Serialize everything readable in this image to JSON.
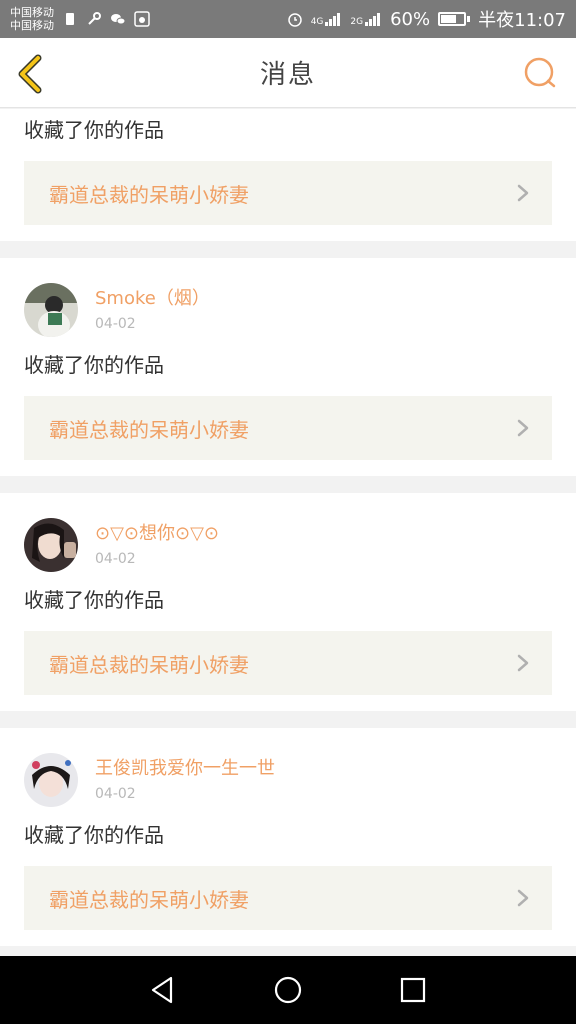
{
  "status_bar": {
    "carrier_1": "中国移动",
    "carrier_2": "中国移动",
    "network_1": "4G",
    "network_2": "2G",
    "battery": "60%",
    "time": "半夜11:07"
  },
  "nav": {
    "title": "消息",
    "accent_color": "#f0a065"
  },
  "messages": [
    {
      "action": "收藏了你的作品",
      "work_title": "霸道总裁的呆萌小娇妻"
    },
    {
      "username": "Smoke（烟）",
      "date": "04-02",
      "action": "收藏了你的作品",
      "work_title": "霸道总裁的呆萌小娇妻"
    },
    {
      "username": "⊙▽⊙想你⊙▽⊙",
      "date": "04-02",
      "action": "收藏了你的作品",
      "work_title": "霸道总裁的呆萌小娇妻"
    },
    {
      "username": "王俊凯我爱你一生一世",
      "date": "04-02",
      "action": "收藏了你的作品",
      "work_title": "霸道总裁的呆萌小娇妻"
    }
  ]
}
